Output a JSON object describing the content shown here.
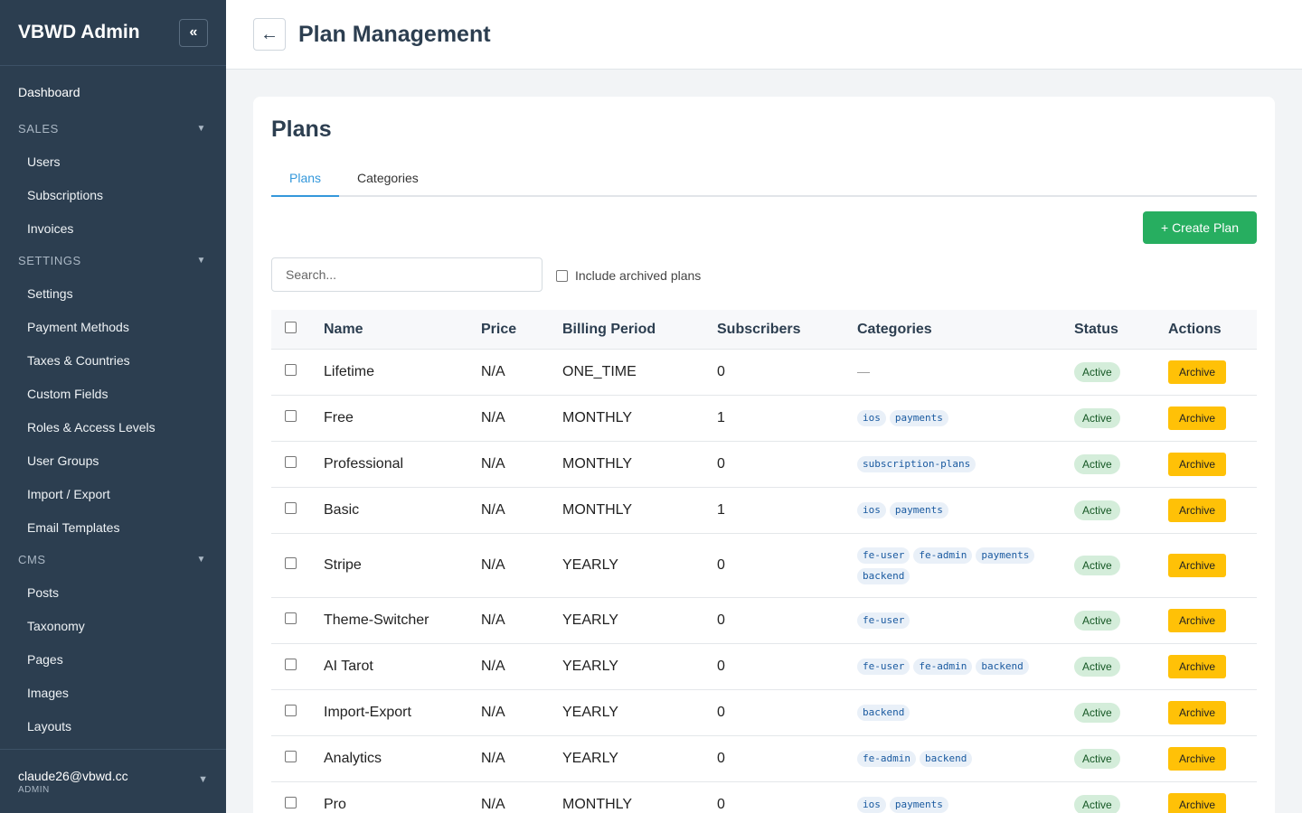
{
  "sidebar": {
    "brand": "VBWD Admin",
    "collapse_icon": "«",
    "dashboard": "Dashboard",
    "sections": [
      {
        "title": "SALES",
        "items": [
          "Users",
          "Subscriptions",
          "Invoices"
        ]
      },
      {
        "title": "SETTINGS",
        "items": [
          "Settings",
          "Payment Methods",
          "Taxes & Countries",
          "Custom Fields",
          "Roles & Access Levels",
          "User Groups",
          "Import / Export",
          "Email Templates"
        ]
      },
      {
        "title": "CMS",
        "items": [
          "Posts",
          "Taxonomy",
          "Pages",
          "Images",
          "Layouts"
        ]
      }
    ],
    "user": {
      "email": "claude26@vbwd.cc",
      "role": "ADMIN"
    }
  },
  "header": {
    "back_icon": "←",
    "title": "Plan Management"
  },
  "main": {
    "card_title": "Plans",
    "tabs": [
      {
        "label": "Plans",
        "active": true
      },
      {
        "label": "Categories",
        "active": false
      }
    ],
    "create_button": "+ Create Plan",
    "search_placeholder": "Search...",
    "include_archived_label": "Include archived plans",
    "columns": [
      "Name",
      "Price",
      "Billing Period",
      "Subscribers",
      "Categories",
      "Status",
      "Actions"
    ],
    "rows": [
      {
        "name": "Lifetime",
        "price": "N/A",
        "period": "ONE_TIME",
        "subscribers": "0",
        "categories": [],
        "status": "Active",
        "action": "Archive"
      },
      {
        "name": "Free",
        "price": "N/A",
        "period": "MONTHLY",
        "subscribers": "1",
        "categories": [
          "ios",
          "payments"
        ],
        "status": "Active",
        "action": "Archive"
      },
      {
        "name": "Professional",
        "price": "N/A",
        "period": "MONTHLY",
        "subscribers": "0",
        "categories": [
          "subscription-plans"
        ],
        "status": "Active",
        "action": "Archive"
      },
      {
        "name": "Basic",
        "price": "N/A",
        "period": "MONTHLY",
        "subscribers": "1",
        "categories": [
          "ios",
          "payments"
        ],
        "status": "Active",
        "action": "Archive"
      },
      {
        "name": "Stripe",
        "price": "N/A",
        "period": "YEARLY",
        "subscribers": "0",
        "categories": [
          "fe-user",
          "fe-admin",
          "payments",
          "backend"
        ],
        "status": "Active",
        "action": "Archive"
      },
      {
        "name": "Theme-Switcher",
        "price": "N/A",
        "period": "YEARLY",
        "subscribers": "0",
        "categories": [
          "fe-user"
        ],
        "status": "Active",
        "action": "Archive"
      },
      {
        "name": "AI Tarot",
        "price": "N/A",
        "period": "YEARLY",
        "subscribers": "0",
        "categories": [
          "fe-user",
          "fe-admin",
          "backend"
        ],
        "status": "Active",
        "action": "Archive"
      },
      {
        "name": "Import-Export",
        "price": "N/A",
        "period": "YEARLY",
        "subscribers": "0",
        "categories": [
          "backend"
        ],
        "status": "Active",
        "action": "Archive"
      },
      {
        "name": "Analytics",
        "price": "N/A",
        "period": "YEARLY",
        "subscribers": "0",
        "categories": [
          "fe-admin",
          "backend"
        ],
        "status": "Active",
        "action": "Archive"
      },
      {
        "name": "Pro",
        "price": "N/A",
        "period": "MONTHLY",
        "subscribers": "0",
        "categories": [
          "ios",
          "payments"
        ],
        "status": "Active",
        "action": "Archive"
      }
    ],
    "empty_category": "—"
  },
  "colors": {
    "sidebar_bg": "#2c3e50",
    "accent": "#3498db",
    "create_button": "#27ae60",
    "archive_button": "#ffc107",
    "active_badge": "#d4edda"
  }
}
